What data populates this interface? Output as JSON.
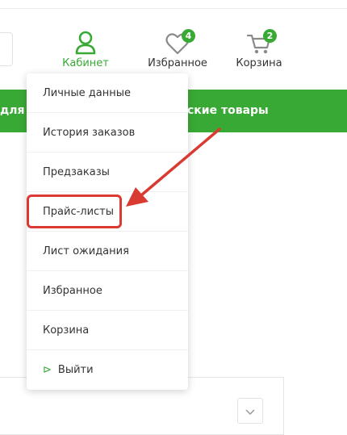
{
  "header": {
    "cabinet_label": "Кабинет",
    "favorites_label": "Избранное",
    "favorites_count": "4",
    "cart_label": "Корзина",
    "cart_count": "2"
  },
  "banner": {
    "left_text": "для ж",
    "right_text": "ские товары"
  },
  "menu": {
    "items": [
      {
        "label": "Личные данные"
      },
      {
        "label": "История заказов"
      },
      {
        "label": "Предзаказы"
      },
      {
        "label": "Прайс-листы"
      },
      {
        "label": "Лист ожидания"
      },
      {
        "label": "Избранное"
      },
      {
        "label": "Корзина"
      },
      {
        "label": "Выйти"
      }
    ]
  },
  "colors": {
    "accent": "#39a935",
    "annotation": "#d93a32"
  }
}
